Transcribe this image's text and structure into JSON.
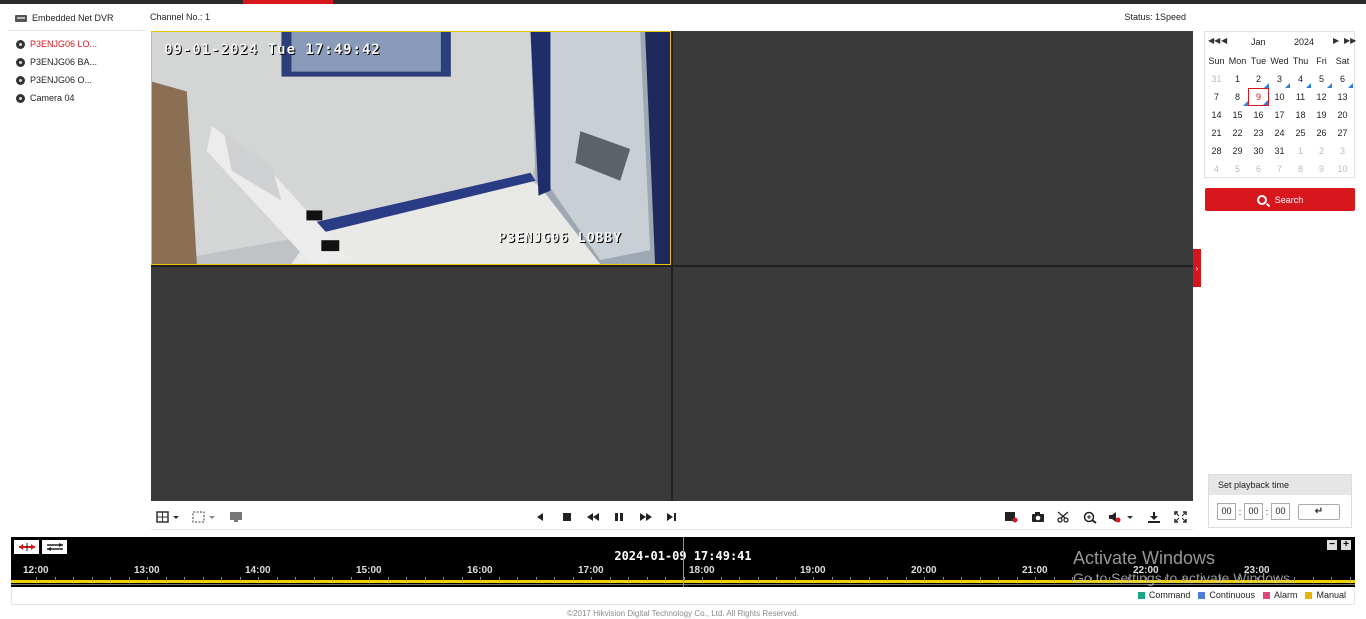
{
  "device": {
    "name": "Embedded Net DVR"
  },
  "channels": [
    {
      "label": "P3ENJG06 LO...",
      "active": true
    },
    {
      "label": "P3ENJG06 BA...",
      "active": false
    },
    {
      "label": "P3ENJG06 O...",
      "active": false
    },
    {
      "label": "Camera 04",
      "active": false
    }
  ],
  "header": {
    "channel_no": "Channel No.: 1",
    "status": "Status: 1Speed"
  },
  "video": {
    "osd_time": "09-01-2024 Tue 17:49:42",
    "osd_name": "P3ENJG06 LOBBY"
  },
  "calendar": {
    "month": "Jan",
    "year": "2024",
    "weekdays": [
      "Sun",
      "Mon",
      "Tue",
      "Wed",
      "Thu",
      "Fri",
      "Sat"
    ],
    "days": [
      {
        "d": "31",
        "other": true
      },
      {
        "d": "1"
      },
      {
        "d": "2",
        "rec": true
      },
      {
        "d": "3",
        "rec": true
      },
      {
        "d": "4",
        "rec": true
      },
      {
        "d": "5",
        "rec": true
      },
      {
        "d": "6",
        "rec": true
      },
      {
        "d": "7"
      },
      {
        "d": "8",
        "rec": true
      },
      {
        "d": "9",
        "sel": true,
        "rec": true
      },
      {
        "d": "10"
      },
      {
        "d": "11"
      },
      {
        "d": "12"
      },
      {
        "d": "13"
      },
      {
        "d": "14"
      },
      {
        "d": "15"
      },
      {
        "d": "16"
      },
      {
        "d": "17"
      },
      {
        "d": "18"
      },
      {
        "d": "19"
      },
      {
        "d": "20"
      },
      {
        "d": "21"
      },
      {
        "d": "22"
      },
      {
        "d": "23"
      },
      {
        "d": "24"
      },
      {
        "d": "25"
      },
      {
        "d": "26"
      },
      {
        "d": "27"
      },
      {
        "d": "28"
      },
      {
        "d": "29"
      },
      {
        "d": "30"
      },
      {
        "d": "31"
      },
      {
        "d": "1",
        "other": true
      },
      {
        "d": "2",
        "other": true
      },
      {
        "d": "3",
        "other": true
      },
      {
        "d": "4",
        "other": true
      },
      {
        "d": "5",
        "other": true
      },
      {
        "d": "6",
        "other": true
      },
      {
        "d": "7",
        "other": true
      },
      {
        "d": "8",
        "other": true
      },
      {
        "d": "9",
        "other": true
      },
      {
        "d": "10",
        "other": true
      }
    ]
  },
  "search": {
    "label": "Search"
  },
  "playback_time": {
    "title": "Set playback time",
    "hh": "00",
    "mm": "00",
    "ss": "00"
  },
  "timeline": {
    "current": "2024-01-09 17:49:41",
    "ticks": [
      "12:00",
      "13:00",
      "14:00",
      "15:00",
      "16:00",
      "17:00",
      "18:00",
      "19:00",
      "20:00",
      "21:00",
      "22:00",
      "23:00"
    ]
  },
  "legend": [
    {
      "label": "Command",
      "color": "#1aa68a"
    },
    {
      "label": "Continuous",
      "color": "#4f7fd6"
    },
    {
      "label": "Alarm",
      "color": "#e0457b"
    },
    {
      "label": "Manual",
      "color": "#e8b400"
    }
  ],
  "colors": {
    "accent": "#d7161e",
    "selection": "#f0c300"
  },
  "footer": {
    "text": "©2017 Hikvision Digital Technology Co., Ltd. All Rights Reserved."
  },
  "watermark": {
    "line1": "Activate Windows",
    "line2": "Go to Settings to activate Windows."
  }
}
